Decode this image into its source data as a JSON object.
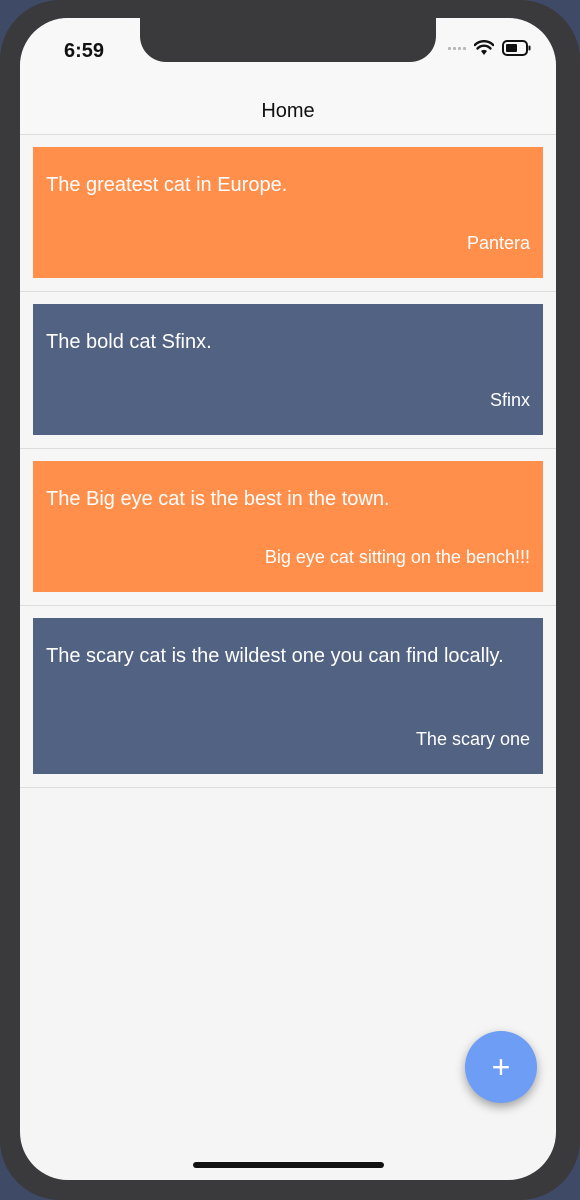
{
  "status": {
    "time": "6:59"
  },
  "nav": {
    "title": "Home"
  },
  "cards": [
    {
      "title": "The greatest cat in Europe.",
      "subtitle": "Pantera",
      "color": "#ff8f4b"
    },
    {
      "title": "The bold cat Sfinx.",
      "subtitle": "Sfinx",
      "color": "#526282"
    },
    {
      "title": "The Big eye cat is the best in the town.",
      "subtitle": "Big eye cat sitting on the bench!!!",
      "color": "#ff8f4b"
    },
    {
      "title": "The scary cat is the wildest one you can find locally.",
      "subtitle": "The scary one",
      "color": "#526282"
    }
  ],
  "fab": {
    "label": "+",
    "color": "#6d9df5"
  },
  "icons": {
    "wifi": "wifi-icon",
    "battery": "battery-icon",
    "signal": "signal-icon",
    "add": "plus-icon"
  }
}
